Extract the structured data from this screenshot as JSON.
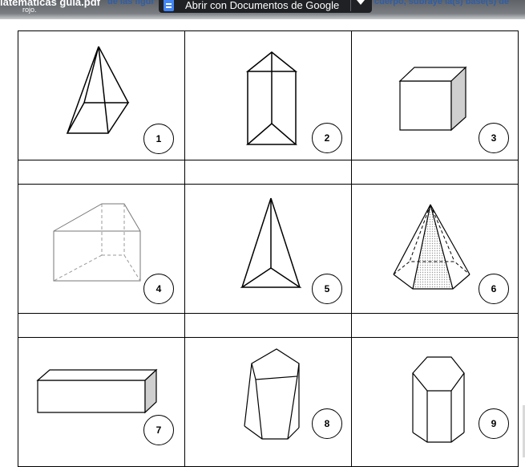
{
  "viewer": {
    "file_title": "latemáticas guia.pdf",
    "file_sub": "rojo.",
    "bg_left": "de las figur",
    "bg_right": "cuerpo, subraye la(s) base(s) de",
    "open_with_label": "Abrir con Documentos de Google",
    "icons": [
      "docs-icon",
      "chevron-down-icon"
    ]
  },
  "figures": {
    "row1": [
      "1",
      "2",
      "3"
    ],
    "row2": [
      "4",
      "5",
      "6"
    ],
    "row3": [
      "7",
      "8",
      "9"
    ]
  }
}
